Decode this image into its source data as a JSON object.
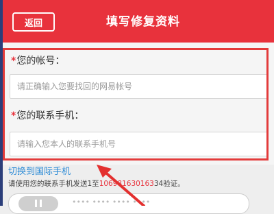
{
  "header": {
    "back_label": "返回",
    "title": "填写修复资料"
  },
  "form": {
    "account": {
      "label": "您的帐号：",
      "placeholder": "请正确输入您要找回的网易帐号"
    },
    "phone": {
      "label": "您的联系手机：",
      "placeholder": "请输入您本人的联系手机号"
    },
    "switch_link": "切换到国际手机"
  },
  "hint": {
    "prefix": "请使用您的联系手机发送1至",
    "number": "106981630163",
    "suffix": "34验证。"
  },
  "colors": {
    "header": "#e8323c",
    "highlight": "#e33b3b",
    "link": "#2a8ad6"
  },
  "icons": {
    "toggle": "toggle-switch-icon",
    "annotation_arrow": "red-arrow-icon"
  }
}
